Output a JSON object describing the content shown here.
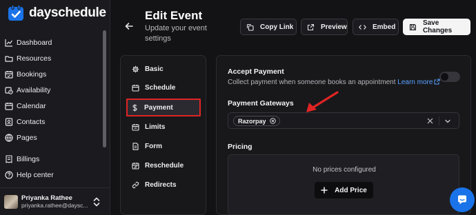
{
  "brand": {
    "name": "dayschedule",
    "accent": "#1a73e8"
  },
  "sidebar": {
    "items": [
      {
        "label": "Dashboard",
        "icon": "chart-line-icon"
      },
      {
        "label": "Resources",
        "icon": "folder-icon"
      },
      {
        "label": "Bookings",
        "icon": "calendar-check-icon"
      },
      {
        "label": "Availability",
        "icon": "calendar-clock-icon"
      },
      {
        "label": "Calendar",
        "icon": "calendar-icon"
      },
      {
        "label": "Contacts",
        "icon": "contacts-icon"
      },
      {
        "label": "Pages",
        "icon": "globe-icon"
      }
    ],
    "bottom_items": [
      {
        "label": "Billings",
        "icon": "receipt-icon"
      },
      {
        "label": "Help center",
        "icon": "help-circle-icon"
      }
    ],
    "user": {
      "name": "Priyanka Rathee",
      "email": "priyanka.rathee@daysc..."
    }
  },
  "header": {
    "title": "Edit Event",
    "subtitle": "Update your event settings",
    "buttons": {
      "copy_link": "Copy Link",
      "preview": "Preview",
      "embed": "Embed",
      "save": "Save Changes"
    }
  },
  "sections": [
    {
      "label": "Basic",
      "icon": "gear-icon"
    },
    {
      "label": "Schedule",
      "icon": "calendar-icon"
    },
    {
      "label": "Payment",
      "icon": "dollar-icon",
      "active": true
    },
    {
      "label": "Limits",
      "icon": "calendar-limit-icon"
    },
    {
      "label": "Form",
      "icon": "form-icon"
    },
    {
      "label": "Reschedule",
      "icon": "calendar-refresh-icon"
    },
    {
      "label": "Redirects",
      "icon": "link-icon"
    }
  ],
  "payment": {
    "accept_title": "Accept Payment",
    "accept_desc": "Collect payment when someone books an appointment",
    "learn_more": "Learn more",
    "accept_enabled": false,
    "gateways_label": "Payment Gateways",
    "gateways_selected": [
      "Razorpay"
    ],
    "pricing_label": "Pricing",
    "no_prices": "No prices configured",
    "add_price": "Add Price"
  },
  "colors": {
    "background": "#131316",
    "highlight_border": "#e02424",
    "annotation_arrow": "#e02424"
  }
}
